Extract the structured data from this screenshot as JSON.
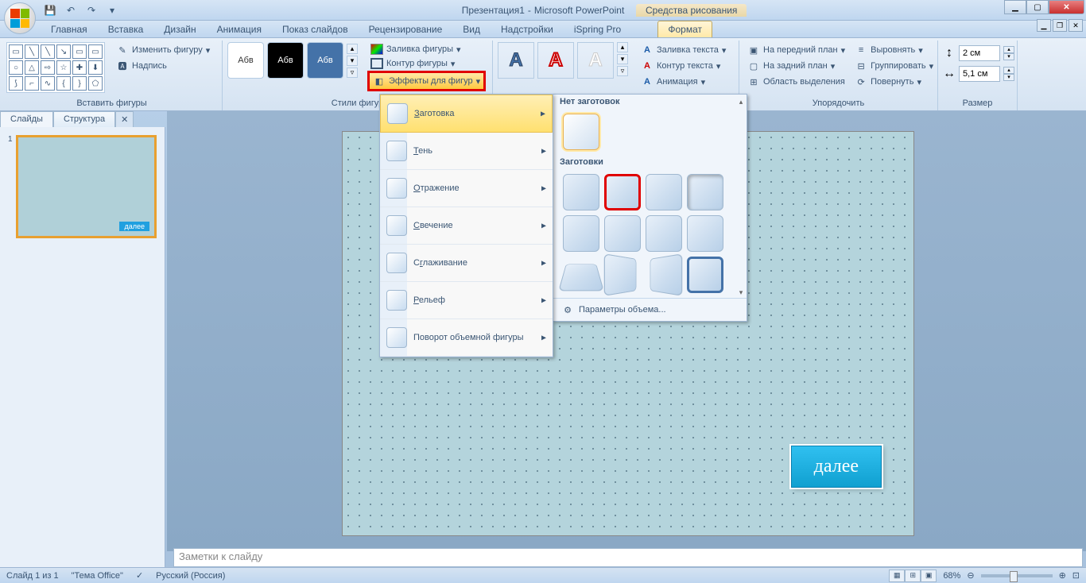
{
  "title": {
    "doc": "Презентация1",
    "app": "Microsoft PowerPoint"
  },
  "contextual_tab_group": "Средства рисования",
  "tabs": [
    "Главная",
    "Вставка",
    "Дизайн",
    "Анимация",
    "Показ слайдов",
    "Рецензирование",
    "Вид",
    "Надстройки",
    "iSpring Pro"
  ],
  "active_tab": "Формат",
  "ribbon": {
    "insert_shapes": {
      "edit_shape": "Изменить фигуру",
      "text_box": "Надпись",
      "label": "Вставить фигуры"
    },
    "shape_styles": {
      "label": "Стили фигур",
      "sample": "Абв",
      "fill": "Заливка фигуры",
      "outline": "Контур фигуры",
      "effects": "Эффекты для фигур"
    },
    "wordart": {
      "sample": "А",
      "text_fill": "Заливка текста",
      "text_outline": "Контур текста",
      "text_effects": "Анимация"
    },
    "arrange": {
      "label": "Упорядочить",
      "front": "На передний план",
      "back": "На задний план",
      "selection": "Область выделения",
      "align": "Выровнять",
      "group": "Группировать",
      "rotate": "Повернуть"
    },
    "size": {
      "label": "Размер",
      "height": "2 см",
      "width": "5,1 см"
    }
  },
  "effects_menu": {
    "preset": "Заготовка",
    "shadow": "Тень",
    "reflection": "Отражение",
    "glow": "Свечение",
    "soft_edges": "Сглаживание",
    "bevel": "Рельеф",
    "rotation3d": "Поворот объемной фигуры"
  },
  "preset_submenu": {
    "none_header": "Нет заготовок",
    "presets_header": "Заготовки",
    "params": "Параметры объема..."
  },
  "panel": {
    "slides_tab": "Слайды",
    "outline_tab": "Структура",
    "slide_num": "1",
    "thumb_btn": "далее"
  },
  "canvas": {
    "next_btn": "далее"
  },
  "notes_placeholder": "Заметки к слайду",
  "status": {
    "slide": "Слайд 1 из 1",
    "theme": "\"Тema Office\"",
    "theme2": "\"Тема Office\"",
    "lang": "Русский (Россия)",
    "zoom": "68%"
  }
}
